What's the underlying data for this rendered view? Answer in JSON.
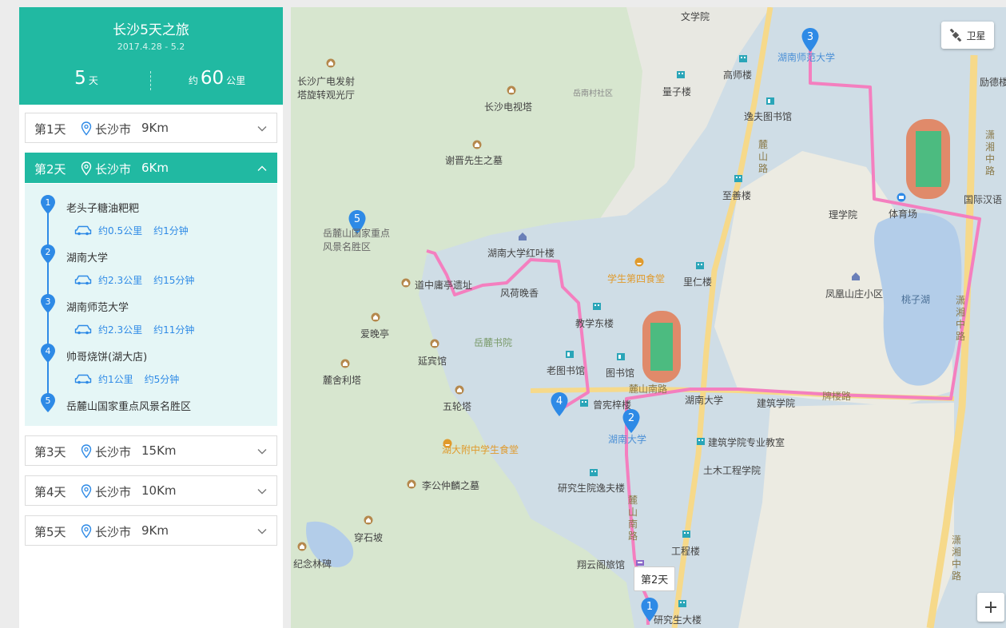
{
  "trip": {
    "title": "长沙5天之旅",
    "dates": "2017.4.28 - 5.2",
    "days_value": "5",
    "days_unit": "天",
    "distance_prefix": "约",
    "distance_value": "60",
    "distance_unit": "公里"
  },
  "days": [
    {
      "label": "第1天",
      "city": "长沙市",
      "km": "9Km",
      "expanded": false
    },
    {
      "label": "第2天",
      "city": "长沙市",
      "km": "6Km",
      "expanded": true
    },
    {
      "label": "第3天",
      "city": "长沙市",
      "km": "15Km",
      "expanded": false
    },
    {
      "label": "第4天",
      "city": "长沙市",
      "km": "10Km",
      "expanded": false
    },
    {
      "label": "第5天",
      "city": "长沙市",
      "km": "9Km",
      "expanded": false
    }
  ],
  "day2": {
    "stops": [
      {
        "num": "1",
        "name": "老头子糖油粑粑"
      },
      {
        "num": "2",
        "name": "湖南大学"
      },
      {
        "num": "3",
        "name": "湖南师范大学"
      },
      {
        "num": "4",
        "name": "帅哥烧饼(湖大店)"
      },
      {
        "num": "5",
        "name": "岳麓山国家重点风景名胜区"
      }
    ],
    "legs": [
      {
        "distance": "约0.5公里",
        "time": "约1分钟"
      },
      {
        "distance": "约2.3公里",
        "time": "约15分钟"
      },
      {
        "distance": "约2.3公里",
        "time": "约11分钟"
      },
      {
        "distance": "约1公里",
        "time": "约5分钟"
      }
    ]
  },
  "map": {
    "satellite_label": "卫星",
    "day_tag": "第2天",
    "route_color": "#f47fbf",
    "marker_color": "#2e8ae6",
    "markers": [
      "1",
      "2",
      "3",
      "4",
      "5"
    ],
    "labels": {
      "wenxueyuan": "文学院",
      "guangdian": "长沙广电发射塔旋转观光厅",
      "dianshita": "长沙电视塔",
      "yuenancun": "岳南村社区",
      "xiejin": "谢晋先生之墓",
      "liangzilou": "量子楼",
      "gaoshilou": "高师楼",
      "yifu_lib": "逸夫图书馆",
      "hnsd": "湖南师范大学",
      "lideguan": "励德楼",
      "lushanlu": "麓山路",
      "zhishanlou": "至善楼",
      "lixueyuan": "理学院",
      "tiyuchang": "体育场",
      "guoji": "国际汉语",
      "xiangzhonglu_top": "潇湘中路",
      "yuelushan": "岳麓山国家重点风景名胜区",
      "hongyelou": "湖南大学红叶楼",
      "sishitang": "学生第四食堂",
      "lirenlou": "里仁楼",
      "fenghuangshan": "凤凰山庄小区",
      "taozihu": "桃子湖",
      "daozhong": "道中庸亭遗址",
      "fenghe": "风荷晚香",
      "aiwanting": "爱晚亭",
      "yuelushuyuan": "岳麓书院",
      "jiaoxuedong": "教学东楼",
      "yanbinguan": "延宾馆",
      "laotushuguan": "老图书馆",
      "tushuguan": "图书馆",
      "xiangzhonglu_mid": "潇湘中路",
      "lusheli": "麓舍利塔",
      "lushannanlu": "麓山南路",
      "hunandaxue_small": "湖南大学",
      "jianzhu": "建筑学院",
      "wulunta": "五轮塔",
      "zengxianzi": "曾宪梓楼",
      "hunandaxue": "湖南大学",
      "paloulu": "牌楼路",
      "fuzhong": "湖大附中学生食堂",
      "jianzhu_jiaoshi": "建筑学院专业教室",
      "tumu": "土木工程学院",
      "ligongzhong": "李公仲麟之墓",
      "yanjiuyuan_yifu": "研究生院逸夫楼",
      "lushannanlu_v": "麓山南路",
      "chuanshipo": "穿石坡",
      "gongchenglou": "工程楼",
      "jinianlinbei": "纪念林碑",
      "xiangyun": "翔云阁旅馆",
      "xiangzhonglu_bot": "潇湘中路",
      "yanjiushengdalou": "研究生大楼"
    }
  }
}
